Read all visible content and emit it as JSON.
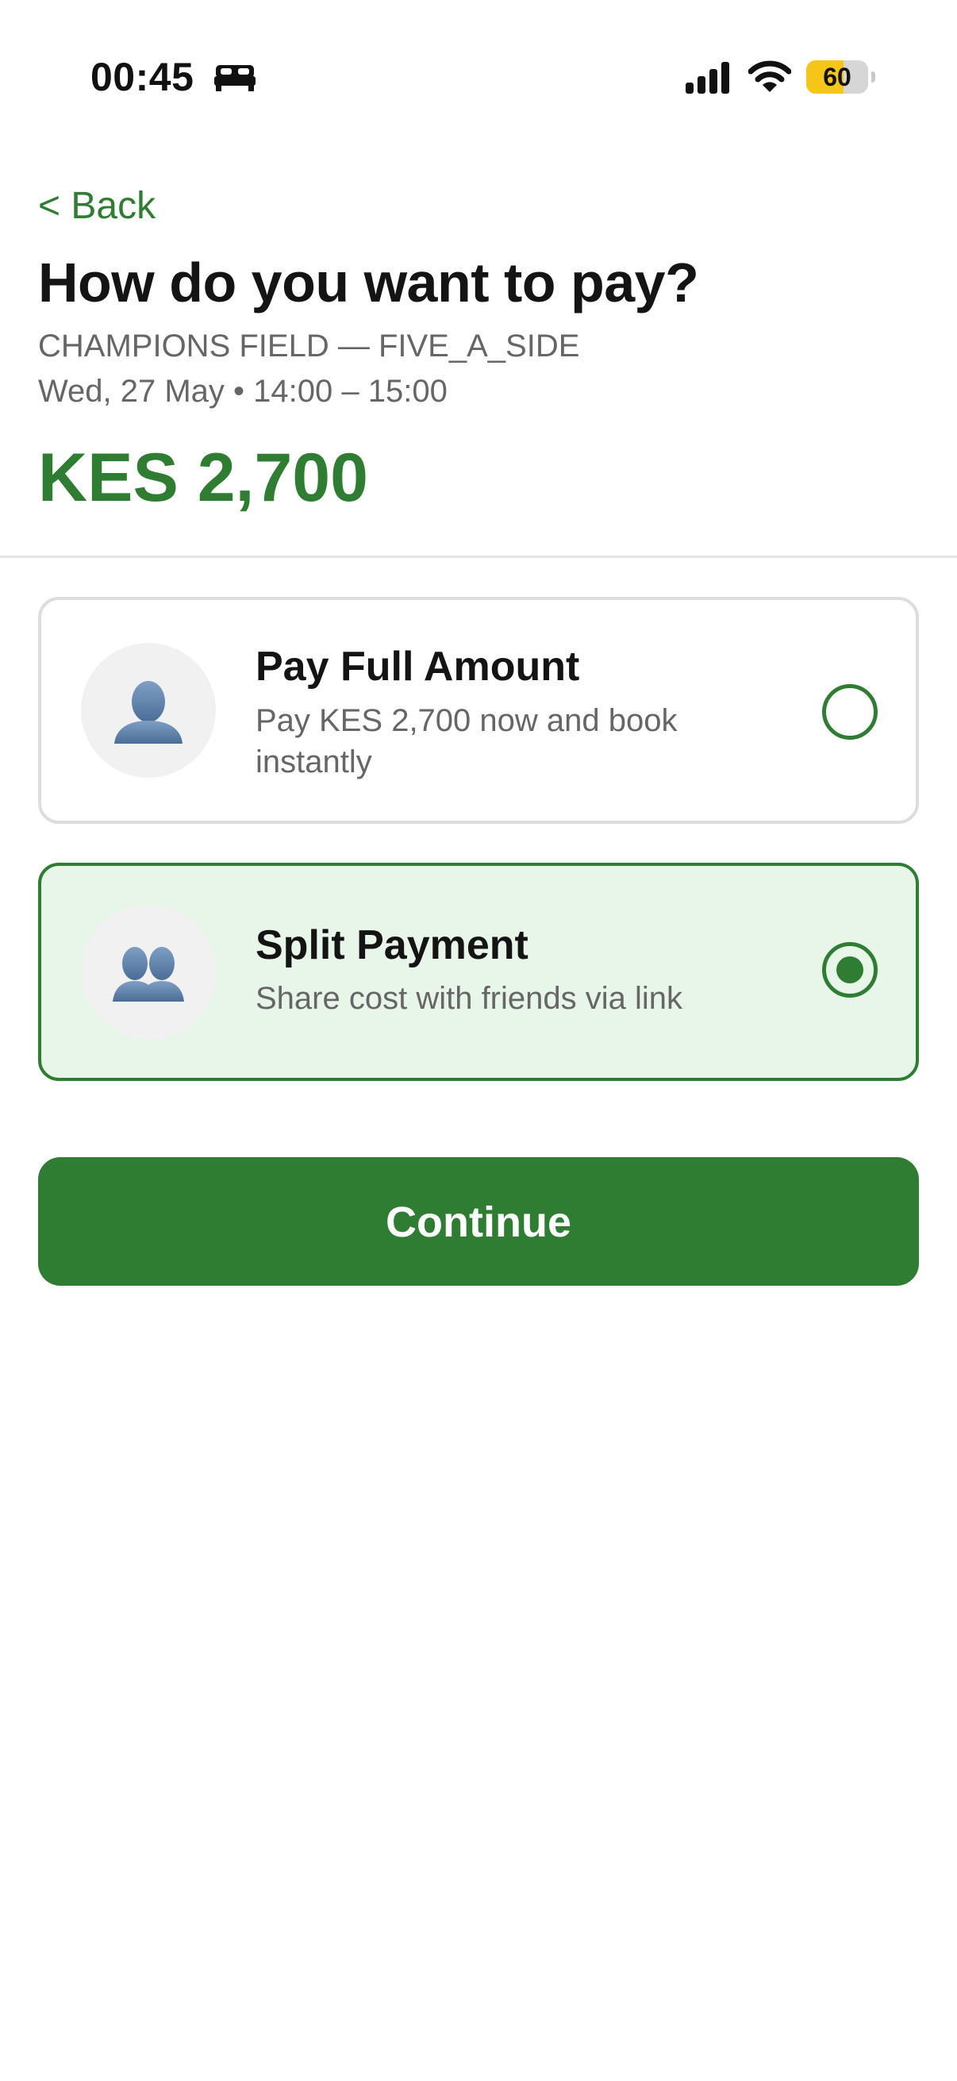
{
  "status_bar": {
    "time": "00:45",
    "battery_level": "60",
    "battery_fraction": 0.6,
    "icons": [
      "bed-icon",
      "signal-icon",
      "wifi-icon",
      "battery-icon"
    ]
  },
  "header": {
    "back_label": "< Back",
    "title": "How do you want to pay?",
    "venue": "CHAMPIONS FIELD — FIVE_A_SIDE",
    "slot": "Wed, 27 May • 14:00 – 15:00",
    "amount": "KES 2,700"
  },
  "options": [
    {
      "title": "Pay Full Amount",
      "description": "Pay KES 2,700 now and book instantly",
      "icon": "single-person-icon",
      "selected": false
    },
    {
      "title": "Split Payment",
      "description": "Share cost with friends via link",
      "icon": "two-people-icon",
      "selected": true
    }
  ],
  "continue_label": "Continue",
  "colors": {
    "accent": "#2e7d32",
    "selected_bg": "#e8f5e9",
    "battery": "#f5c518"
  }
}
